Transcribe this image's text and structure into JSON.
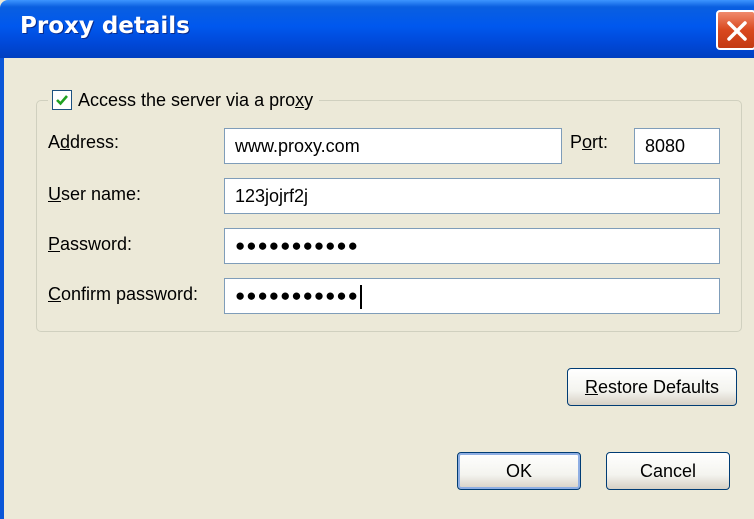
{
  "window": {
    "title": "Proxy details",
    "close_icon": "close-x-icon"
  },
  "proxy_group": {
    "checkbox_label_pre": "Access the server via a pro",
    "checkbox_label_accel": "x",
    "checkbox_label_post": "y",
    "checked": true
  },
  "fields": {
    "address": {
      "label_pre": "A",
      "label_accel": "d",
      "label_post": "dress:",
      "value": "www.proxy.com"
    },
    "port": {
      "label_pre": "P",
      "label_accel": "o",
      "label_post": "rt:",
      "value": "8080"
    },
    "username": {
      "label_pre": "",
      "label_accel": "U",
      "label_post": "ser name:",
      "value": "123jojrf2j"
    },
    "password": {
      "label_pre": "",
      "label_accel": "P",
      "label_post": "assword:",
      "value": "●●●●●●●●●●●"
    },
    "confirm_password": {
      "label_pre": "",
      "label_accel": "C",
      "label_post": "onfirm password:",
      "value": "●●●●●●●●●●●"
    }
  },
  "buttons": {
    "restore_defaults": {
      "accel": "R",
      "rest": "estore Defaults"
    },
    "ok": "OK",
    "cancel": "Cancel"
  }
}
